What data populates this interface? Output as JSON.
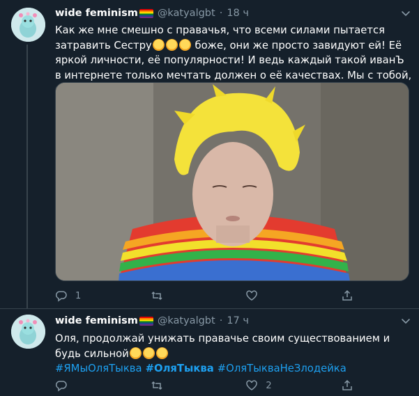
{
  "tweets": [
    {
      "author_name": "wide feminism",
      "handle": "@katyalgbt",
      "separator": "·",
      "time": "18 ч",
      "text_before_emoji": "Как же мне смешно с правачья, что всеми силами пытается затравить Сестру",
      "text_after_emoji": " боже, они же просто завидуют ей! Её яркой личности, её популярности! И ведь каждый такой иванЪ в интернете только мечтать должен о её качествах. Мы с тобой, Сестра",
      "counts": {
        "reply": "1",
        "retweet": "",
        "like": "",
        "share": ""
      }
    },
    {
      "author_name": "wide feminism",
      "handle": "@katyalgbt",
      "separator": "·",
      "time": "17 ч",
      "text": "Оля, продолжай унижать правачье своим существованием и будь сильной",
      "hashtags": [
        "#ЯМыОляТыква",
        "#ОляТыква",
        "#ОляТыкваНеЗлодейка"
      ],
      "counts": {
        "reply": "",
        "retweet": "",
        "like": "2",
        "share": ""
      }
    }
  ],
  "icons": {
    "reply": "reply-icon",
    "retweet": "retweet-icon",
    "like": "heart-icon",
    "share": "share-icon",
    "more": "chevron-down-icon"
  },
  "colors": {
    "background": "#15202b",
    "border": "#38444d",
    "secondary_text": "#8899a6",
    "link": "#1da1f2"
  }
}
